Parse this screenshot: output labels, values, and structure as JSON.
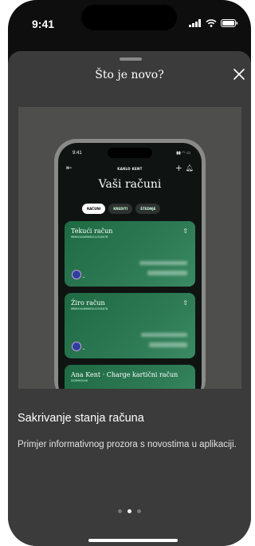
{
  "status_bar": {
    "time": "9:41"
  },
  "sheet": {
    "title": "Što je novo?"
  },
  "preview_phone": {
    "time": "9:41",
    "user_name": "KARLO KENT",
    "heading": "Vaši računi",
    "tabs": [
      {
        "label": "RAČUNI",
        "active": true
      },
      {
        "label": "KREDITI",
        "active": false
      },
      {
        "label": "ŠTEDNJE",
        "active": false
      }
    ],
    "accounts": [
      {
        "name": "Tekući račun",
        "iban": "HR0024840008321234567B"
      },
      {
        "name": "Žiro račun",
        "iban": "HR0024840008321234567B"
      },
      {
        "name": "Ana Kent · Charge kartični račun",
        "iban": "3220003246"
      }
    ]
  },
  "caption": {
    "title": "Sakrivanje stanja računa",
    "body": "Primjer informativnog prozora s novostima u aplikaciji."
  },
  "pagination": {
    "current": 2,
    "total": 3
  },
  "colors": {
    "sheet_bg": "#3a3b3a",
    "card_green": "#2d7a55",
    "accent": "#ffffff"
  }
}
